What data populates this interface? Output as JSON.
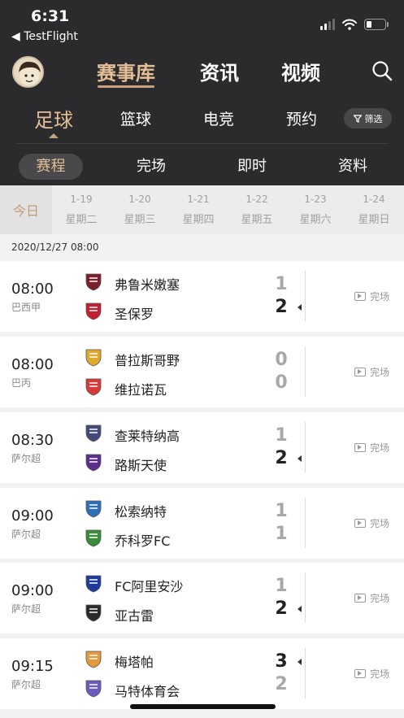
{
  "status_bar": {
    "time": "6:31",
    "back_label": "◀ TestFlight"
  },
  "top_nav": {
    "tabs": [
      "赛事库",
      "资讯",
      "视频"
    ],
    "active": "赛事库"
  },
  "sport_tabs": [
    "足球",
    "篮球",
    "电竞",
    "预约"
  ],
  "filter_label": "筛选",
  "sub_tabs": [
    "赛程",
    "完场",
    "即时",
    "资料"
  ],
  "date_strip": {
    "today_label": "今日",
    "dates": [
      {
        "date": "1-19",
        "weekday": "星期二"
      },
      {
        "date": "1-20",
        "weekday": "星期三"
      },
      {
        "date": "1-21",
        "weekday": "星期四"
      },
      {
        "date": "1-22",
        "weekday": "星期五"
      },
      {
        "date": "1-23",
        "weekday": "星期六"
      },
      {
        "date": "1-24",
        "weekday": "星期日"
      }
    ]
  },
  "section_date": "2020/12/27 08:00",
  "matches": [
    {
      "time": "08:00",
      "league": "巴西甲",
      "home": "弗鲁米嫩塞",
      "away": "圣保罗",
      "home_score": "1",
      "away_score": "2",
      "status": "完场",
      "home_color": "#7a1f2b",
      "away_color": "#c21f2f"
    },
    {
      "time": "08:00",
      "league": "巴丙",
      "home": "普拉斯哥野",
      "away": "维拉诺瓦",
      "home_score": "0",
      "away_score": "0",
      "status": "完场",
      "home_color": "#e0a92a",
      "away_color": "#d63a3a"
    },
    {
      "time": "08:30",
      "league": "萨尔超",
      "home": "查莱特纳高",
      "away": "路斯天使",
      "home_score": "1",
      "away_score": "2",
      "status": "完场",
      "home_color": "#444a78",
      "away_color": "#5b2d8c"
    },
    {
      "time": "09:00",
      "league": "萨尔超",
      "home": "松索纳特",
      "away": "乔科罗FC",
      "home_score": "1",
      "away_score": "1",
      "status": "完场",
      "home_color": "#2e6fb8",
      "away_color": "#3a8c3a"
    },
    {
      "time": "09:00",
      "league": "萨尔超",
      "home": "FC阿里安沙",
      "away": "亚古雷",
      "home_score": "1",
      "away_score": "2",
      "status": "完场",
      "home_color": "#1e3a9c",
      "away_color": "#2b2b2b"
    },
    {
      "time": "09:15",
      "league": "萨尔超",
      "home": "梅塔帕",
      "away": "马特体育会",
      "home_score": "3",
      "away_score": "2",
      "status": "完场",
      "home_color": "#e49a3a",
      "away_color": "#6a5bbd"
    }
  ]
}
